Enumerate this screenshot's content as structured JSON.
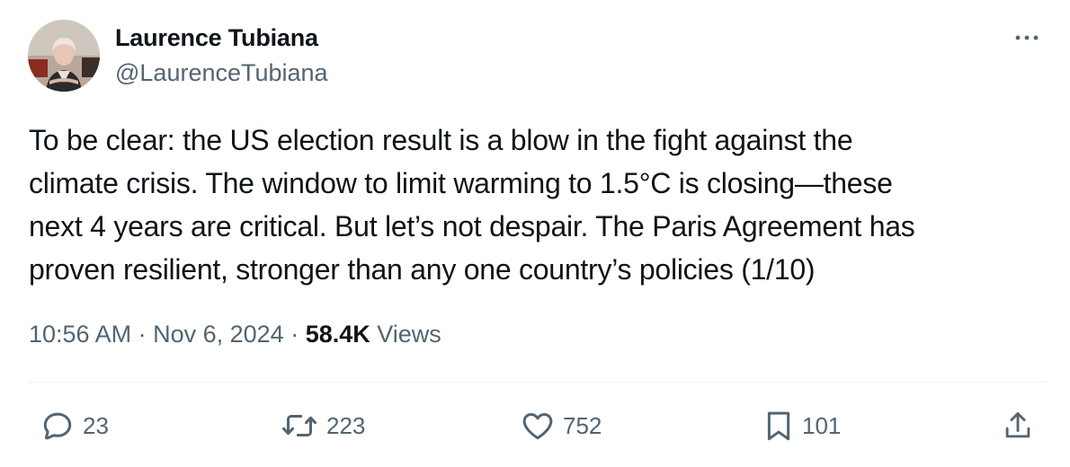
{
  "author": {
    "name": "Laurence Tubiana",
    "handle": "@LaurenceTubiana"
  },
  "tweet": {
    "text": "To be clear: the US election result is a blow in the fight against the\nclimate crisis. The window to limit warming to 1.5°C is closing—these\nnext 4 years are critical. But let’s not despair. The Paris Agreement has\nproven resilient, stronger than any one country’s policies (1/10)"
  },
  "meta": {
    "time": "10:56 AM",
    "separator": " · ",
    "date": "Nov 6, 2024",
    "views_count": "58.4K",
    "views_label": " Views"
  },
  "actions": {
    "replies": "23",
    "reposts": "223",
    "likes": "752",
    "bookmarks": "101"
  },
  "icons": {
    "more": "more-dots-icon",
    "reply": "reply-bubble-icon",
    "repost": "repost-arrows-icon",
    "like": "heart-icon",
    "bookmark": "bookmark-icon",
    "share": "share-upload-icon"
  },
  "colors": {
    "text_primary": "#0f1419",
    "text_secondary": "#536471",
    "divider": "#eff3f4",
    "background": "#ffffff"
  }
}
